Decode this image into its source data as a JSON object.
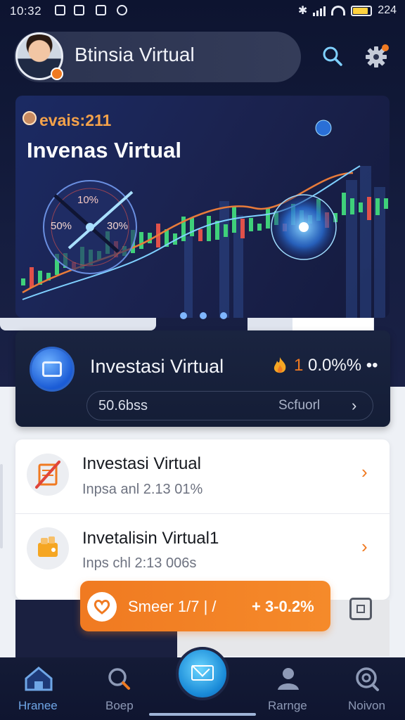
{
  "status_bar": {
    "time": "10:32",
    "battery": "224"
  },
  "header": {
    "title": "Btinsia Virtual"
  },
  "banner": {
    "kicker": "evais:211",
    "title": "Invenas Virtual",
    "gauge_labels": [
      "10%",
      "50%",
      "30%"
    ]
  },
  "invest_card": {
    "title": "Investasi Virtual",
    "pct_prefix": "1",
    "pct_rest": "0.0%% ••",
    "amount": "50.6bss",
    "schedule": "Scfuorl",
    "chevron": "›"
  },
  "list": [
    {
      "title": "Investasi Virtual",
      "subtitle": "Inpsa anl 2.13 01%",
      "icon": "calculator-icon",
      "chevron": "›"
    },
    {
      "title": "Invetalisin Virtual1",
      "subtitle": "Inps chl 2:13 006s",
      "icon": "wallet-icon",
      "chevron": "›"
    }
  ],
  "smart_button": {
    "label": "Smeer 1/7 | /",
    "value": "+ 3-0.2%"
  },
  "nav": {
    "items": [
      {
        "label": "Hranee",
        "icon": "home-icon"
      },
      {
        "label": "Boep",
        "icon": "search-icon"
      },
      {
        "label": "Rarnge",
        "icon": "user-icon"
      },
      {
        "label": "Noivon",
        "icon": "notifications-icon"
      }
    ]
  },
  "colors": {
    "accent": "#f07a21",
    "dark": "#141b36",
    "blue": "#1a8bd8"
  }
}
